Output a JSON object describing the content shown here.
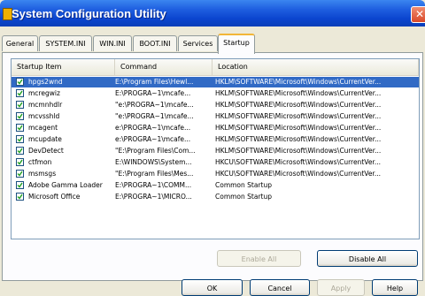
{
  "window": {
    "title": "System Configuration Utility",
    "close_glyph": "✕"
  },
  "tabs": [
    {
      "label": "General"
    },
    {
      "label": "SYSTEM.INI"
    },
    {
      "label": "WIN.INI"
    },
    {
      "label": "BOOT.INI"
    },
    {
      "label": "Services"
    },
    {
      "label": "Startup",
      "active": true
    }
  ],
  "list": {
    "columns": [
      "Startup Item",
      "Command",
      "Location"
    ],
    "rows": [
      {
        "checked": true,
        "item": "hpgs2wnd",
        "command": "E:\\Program Files\\Hewl...",
        "location": "HKLM\\SOFTWARE\\Microsoft\\Windows\\CurrentVer...",
        "selected": true
      },
      {
        "checked": true,
        "item": "mcregwiz",
        "command": "E:\\PROGRA~1\\mcafe...",
        "location": "HKLM\\SOFTWARE\\Microsoft\\Windows\\CurrentVer..."
      },
      {
        "checked": true,
        "item": "mcmnhdlr",
        "command": "\"e:\\PROGRA~1\\mcafe...",
        "location": "HKLM\\SOFTWARE\\Microsoft\\Windows\\CurrentVer..."
      },
      {
        "checked": true,
        "item": "mcvsshld",
        "command": "\"e:\\PROGRA~1\\mcafe...",
        "location": "HKLM\\SOFTWARE\\Microsoft\\Windows\\CurrentVer..."
      },
      {
        "checked": true,
        "item": "mcagent",
        "command": "e:\\PROGRA~1\\mcafe...",
        "location": "HKLM\\SOFTWARE\\Microsoft\\Windows\\CurrentVer..."
      },
      {
        "checked": true,
        "item": "mcupdate",
        "command": "e:\\PROGRA~1\\mcafe...",
        "location": "HKLM\\SOFTWARE\\Microsoft\\Windows\\CurrentVer..."
      },
      {
        "checked": true,
        "item": "DevDetect",
        "command": "\"E:\\Program Files\\Com...",
        "location": "HKLM\\SOFTWARE\\Microsoft\\Windows\\CurrentVer..."
      },
      {
        "checked": true,
        "item": "ctfmon",
        "command": "E:\\WINDOWS\\System...",
        "location": "HKCU\\SOFTWARE\\Microsoft\\Windows\\CurrentVer..."
      },
      {
        "checked": true,
        "item": "msmsgs",
        "command": "\"E:\\Program Files\\Mes...",
        "location": "HKCU\\SOFTWARE\\Microsoft\\Windows\\CurrentVer..."
      },
      {
        "checked": true,
        "item": "Adobe Gamma Loader",
        "command": "E:\\PROGRA~1\\COMM...",
        "location": "Common Startup"
      },
      {
        "checked": true,
        "item": "Microsoft Office",
        "command": "E:\\PROGRA~1\\MICRO...",
        "location": "Common Startup"
      }
    ]
  },
  "buttons": {
    "enable_all": "Enable All",
    "disable_all": "Disable All",
    "ok": "OK",
    "cancel": "Cancel",
    "apply": "Apply",
    "help": "Help"
  }
}
